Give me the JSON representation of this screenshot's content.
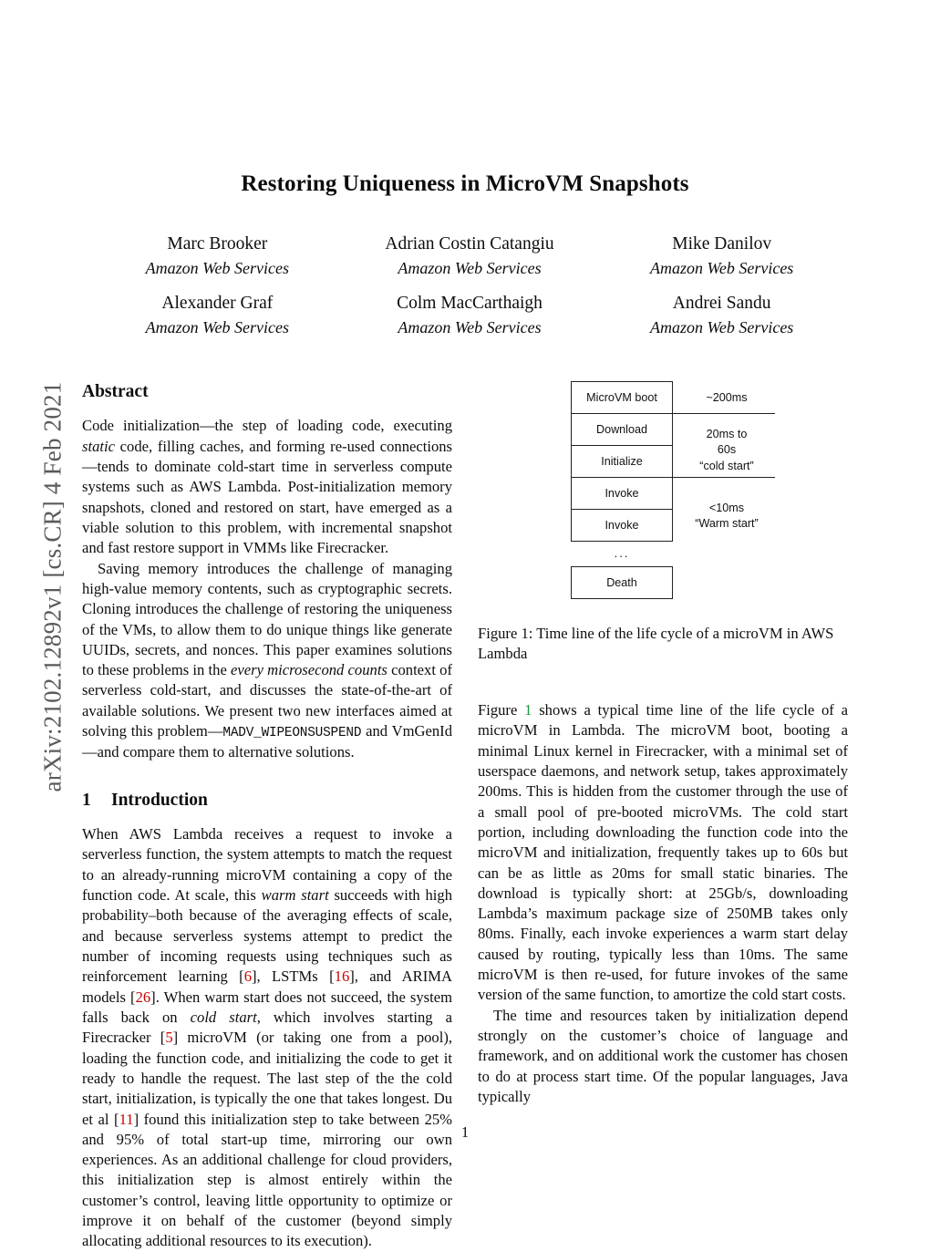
{
  "arxiv_stamp": "arXiv:2102.12892v1  [cs.CR]  4 Feb 2021",
  "title": "Restoring Uniqueness in MicroVM Snapshots",
  "authors": [
    [
      {
        "name": "Marc Brooker",
        "affiliation": "Amazon Web Services"
      },
      {
        "name": "Adrian Costin Catangiu",
        "affiliation": "Amazon Web Services"
      },
      {
        "name": "Mike Danilov",
        "affiliation": "Amazon Web Services"
      }
    ],
    [
      {
        "name": "Alexander Graf",
        "affiliation": "Amazon Web Services"
      },
      {
        "name": "Colm MacCarthaigh",
        "affiliation": "Amazon Web Services"
      },
      {
        "name": "Andrei Sandu",
        "affiliation": "Amazon Web Services"
      }
    ]
  ],
  "abstract": {
    "heading": "Abstract",
    "paragraph1_a": "Code initialization—the step of loading code, executing ",
    "paragraph1_italic": "static",
    "paragraph1_b": " code, filling caches, and forming re-used connections—tends to dominate cold-start time in serverless compute systems such as AWS Lambda. Post-initialization memory snapshots, cloned and restored on start, have emerged as a viable solution to this problem, with incremental snapshot and fast restore support in VMMs like Firecracker.",
    "paragraph2_a": "Saving memory introduces the challenge of managing high-value memory contents, such as cryptographic secrets. Cloning introduces the challenge of restoring the uniqueness of the VMs, to allow them to do unique things like generate UUIDs, secrets, and nonces. This paper examines solutions to these problems in the ",
    "paragraph2_italic": "every microsecond counts",
    "paragraph2_b": " context of serverless cold-start, and discusses the state-of-the-art of available solutions. We present two new interfaces aimed at solving this problem—",
    "paragraph2_mono": "MADV_WIPEONSUSPEND",
    "paragraph2_c": " and VmGenId—and compare them to alternative solutions."
  },
  "introduction": {
    "number": "1",
    "heading": "Introduction",
    "p1_a": "When AWS Lambda receives a request to invoke a serverless function, the system attempts to match the request to an already-running microVM containing a copy of the function code. At scale, this ",
    "p1_italic1": "warm start",
    "p1_b": " succeeds with high probability–both because of the averaging effects of scale, and because serverless systems attempt to predict the number of incoming requests using techniques such as reinforcement learning [",
    "p1_cite1": "6",
    "p1_c": "], LSTMs [",
    "p1_cite2": "16",
    "p1_d": "], and ARIMA models [",
    "p1_cite3": "26",
    "p1_e": "]. When warm start does not succeed, the system falls back on ",
    "p1_italic2": "cold start",
    "p1_f": ", which involves starting a Firecracker [",
    "p1_cite4": "5",
    "p1_g": "] microVM (or taking one from a pool), loading the function code, and initializing the code to get it ready to handle the request. The last step of the the cold start, initialization, is typically the one that takes longest. Du et al [",
    "p1_cite5": "11",
    "p1_h": "] found this initialization step to take between 25% and 95% of total start-up time, mirroring our own experiences. As an additional challenge for cloud providers, this initialization step is almost entirely within the customer’s control, leaving little opportunity to optimize or improve it on behalf of the customer (beyond simply allocating additional resources to its execution).",
    "p2_a": "Figure ",
    "p2_ref": "1",
    "p2_b": " shows a typical time line of the life cycle of a microVM in Lambda. The microVM boot, booting a minimal Linux kernel in Firecracker, with a minimal set of userspace daemons, and network setup, takes approximately 200ms. This is hidden from the customer through the use of a small pool of pre-booted microVMs. The cold start portion, including downloading the function code into the microVM and initialization, frequently takes up to 60s but can be as little as 20ms for small static binaries. The download is typically short: at 25Gb/s, downloading Lambda’s maximum package size of 250MB takes only 80ms. Finally, each invoke experiences a warm start delay caused by routing, typically less than 10ms. The same microVM is then re-used, for future invokes of the same version of the same function, to amortize the cold start costs.",
    "p3": "The time and resources taken by initialization depend strongly on the customer’s choice of language and framework, and on additional work the customer has chosen to do at process start time. Of the popular languages, Java typically"
  },
  "figure": {
    "caption": "Figure 1: Time line of the life cycle of a microVM in AWS Lambda",
    "boxes": [
      {
        "label": "MicroVM boot"
      },
      {
        "label": "Download"
      },
      {
        "label": "Initialize"
      },
      {
        "label": "Invoke"
      },
      {
        "label": "Invoke"
      },
      {
        "label": "Death"
      }
    ],
    "ellipsis": "...",
    "notes": [
      {
        "text": "~200ms"
      },
      {
        "text": "20ms to\n60s\n“cold start”"
      },
      {
        "text": "<10ms\n“Warm start”"
      }
    ],
    "note_boot": "~200ms",
    "note_cold_l1": "20ms to",
    "note_cold_l2": "60s",
    "note_cold_l3": "“cold start”",
    "note_warm_l1": "<10ms",
    "note_warm_l2": "“Warm start”"
  },
  "page_number": "1",
  "colors": {
    "citation": "#cc0000",
    "figure_ref": "#1a9641",
    "box_border": "#222222",
    "stamp": "#5a5a5a"
  }
}
